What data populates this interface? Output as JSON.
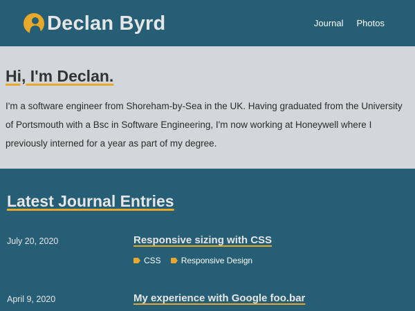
{
  "header": {
    "site_title": "Declan Byrd",
    "logo_icon": "user-silhouette-icon",
    "nav": [
      {
        "label": "Journal"
      },
      {
        "label": "Photos"
      }
    ]
  },
  "intro": {
    "heading": "Hi, I'm Declan.",
    "body": "I'm a software engineer from Shoreham-by-Sea in the UK. Having graduated from the University of Portsmouth with a Bsc in Software Engineering, I'm now working at Honeywell where I previously interned for a year as part of my degree."
  },
  "latest": {
    "title": "Latest Journal Entries",
    "entries": [
      {
        "date": "July 20, 2020",
        "title": "Responsive sizing with CSS",
        "tags": [
          "CSS",
          "Responsive Design"
        ]
      },
      {
        "date": "April 9, 2020",
        "title": "My experience with Google foo.bar",
        "tags": []
      }
    ]
  },
  "colors": {
    "header_bg": "#255e75",
    "intro_bg": "#d3d6db",
    "accent": "#e8a92a"
  }
}
